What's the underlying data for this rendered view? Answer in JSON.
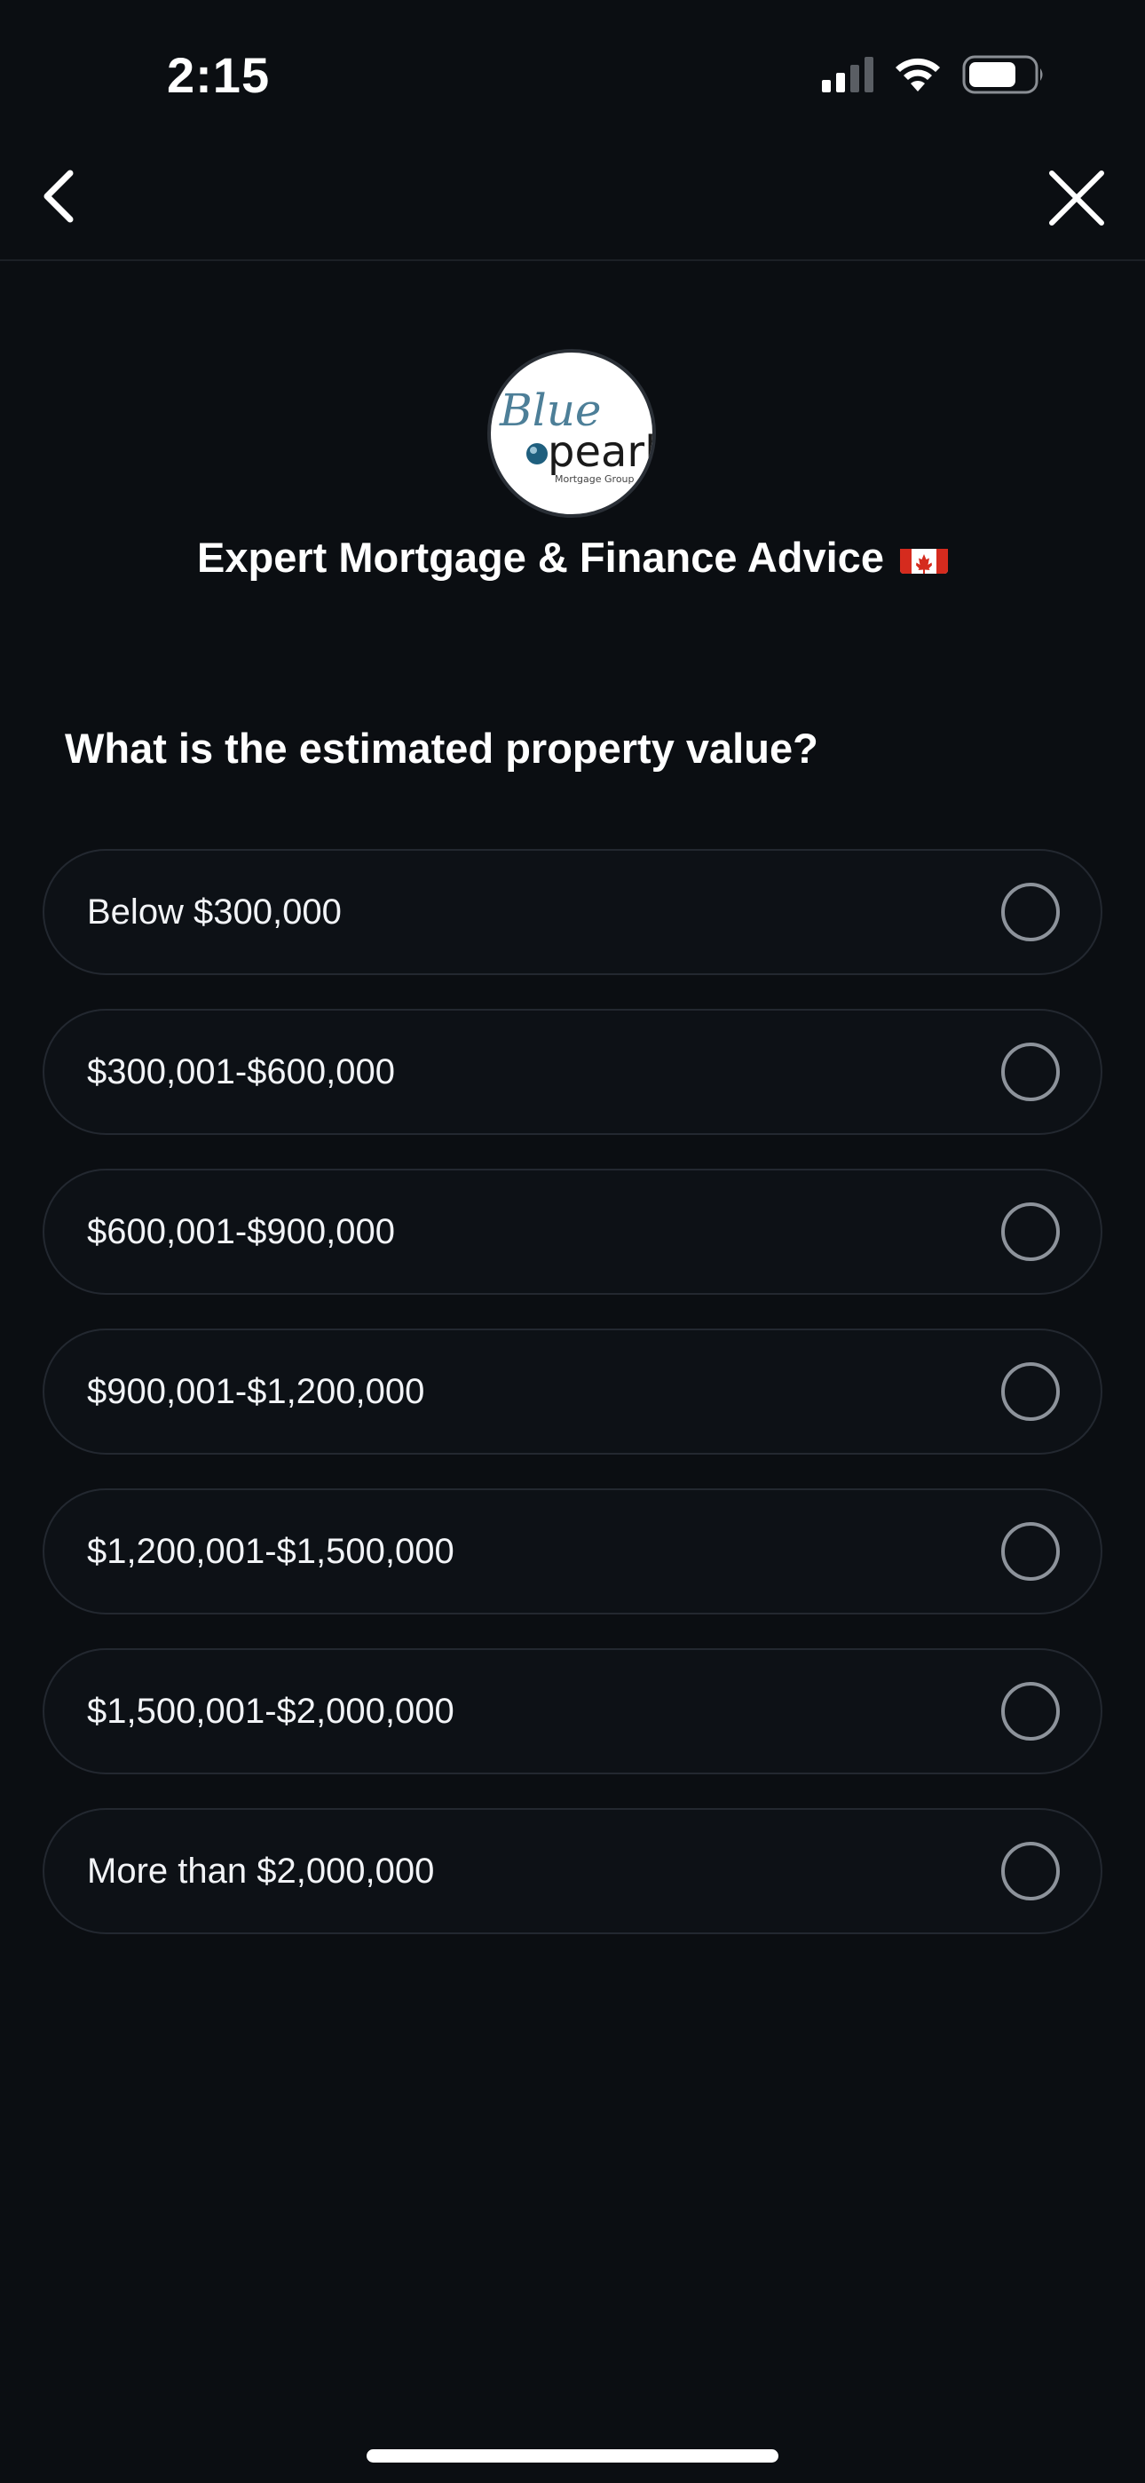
{
  "status_bar": {
    "time": "2:15",
    "icons": [
      "cellular-signal-icon",
      "wifi-icon",
      "battery-icon"
    ]
  },
  "nav": {
    "back_icon": "chevron-left-icon",
    "close_icon": "close-icon"
  },
  "brand": {
    "logo_script": "Blue",
    "logo_word": "pearl",
    "logo_sub": "Mortgage Group",
    "title": "Expert Mortgage & Finance Advice",
    "flag_icon": "canada-flag-icon"
  },
  "question": {
    "text": "What is the estimated property value?"
  },
  "options": [
    {
      "label": "Below $300,000",
      "selected": false
    },
    {
      "label": "$300,001-$600,000",
      "selected": false
    },
    {
      "label": "$600,001-$900,000",
      "selected": false
    },
    {
      "label": "$900,001-$1,200,000",
      "selected": false
    },
    {
      "label": "$1,200,001-$1,500,000",
      "selected": false
    },
    {
      "label": "$1,500,001-$2,000,000",
      "selected": false
    },
    {
      "label": "More than $2,000,000",
      "selected": false
    }
  ],
  "colors": {
    "background": "#0b0e12",
    "option_border": "#232830",
    "radio_border": "#8d939b",
    "logo_blue": "#2f6f8f",
    "flag_red": "#d52b1e"
  }
}
